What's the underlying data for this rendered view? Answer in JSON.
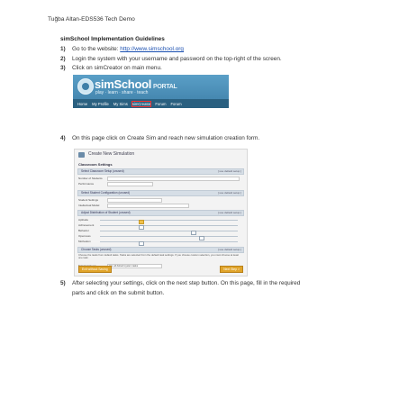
{
  "header": {
    "text": "Tuğba Altan-EDS536 Tech Demo"
  },
  "section_title": "simSchool Implementation Guidelines",
  "steps": [
    {
      "num": "1)",
      "text": "Go to the website: ",
      "link": "http://www.simschool.org"
    },
    {
      "num": "2)",
      "text": "Login the system with your username and password on the top-right of the screen."
    },
    {
      "num": "3)",
      "text": "Click on simCreator on main menu."
    },
    {
      "num": "4)",
      "text": "On this page click on Create Sim and reach new simulation creation form."
    },
    {
      "num": "5)",
      "text": "After selecting your settings, click on the next step button. On this page, fill in the required",
      "text_cont": "parts and click on the submit button."
    }
  ],
  "portal": {
    "brand": "simSchool",
    "brand_suffix": "PORTAL",
    "tagline": "play · learn · share · teach",
    "nav": [
      "Home",
      "My Profile",
      "My Sims",
      "simCreator",
      "Forum",
      "Forum"
    ]
  },
  "form": {
    "title": "Create New Simulation",
    "subtitle": "Classroom Settings",
    "sections": [
      {
        "label": "Select Classroom Setup (unused)",
        "action": "[ use default setup ]"
      },
      {
        "label": "Select Student Configuration (unused)",
        "action": "[ use default setup ]"
      },
      {
        "label": "Adjust Distribution of Student (unused)",
        "action": "[ use default setup ]"
      },
      {
        "label": "Choose Tasks (unused)",
        "action": "[ use default setup ]"
      }
    ],
    "rows": {
      "duration": "Number of Students",
      "performance": "Performance",
      "student_settings": "Student Settings",
      "model": "Intellectual Model",
      "aptitude": "Aptitude",
      "achievement": "Achievement",
      "behavior": "Behavior",
      "openness": "Openness",
      "intrinsic": "Motivation"
    },
    "task_text": "Choose the tasks from default tasks. Tasks are selected from the default task settings. If you choose custom selection, you must choose at least one task.",
    "task_select_label": "Select task set",
    "task_select_value": "Use all default system tasks",
    "buttons": {
      "left": "Exit without Saving",
      "right": "Next Step >"
    }
  }
}
